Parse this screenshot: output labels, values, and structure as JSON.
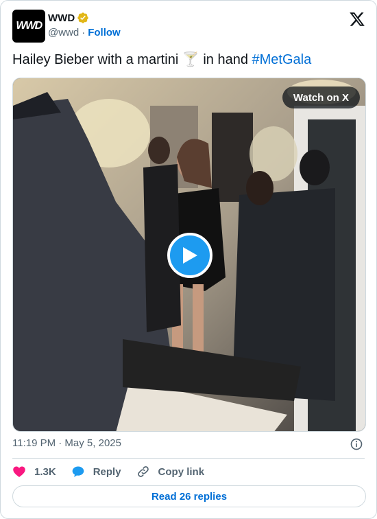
{
  "author": {
    "display_name": "WWD",
    "handle": "@wwd",
    "separator": "·",
    "follow_label": "Follow",
    "avatar_text": "WWD"
  },
  "tweet": {
    "text_before": "Hailey Bieber with a martini 🍸 in hand ",
    "hashtag": "#MetGala"
  },
  "media": {
    "watch_label": "Watch on X"
  },
  "timestamp": "11:19 PM · May 5, 2025",
  "actions": {
    "like_count": "1.3K",
    "reply_label": "Reply",
    "copy_link_label": "Copy link"
  },
  "read_replies_label": "Read 26 replies",
  "colors": {
    "accent": "#006fd6",
    "play": "#1d9bf0",
    "like": "#f91880",
    "text_secondary": "#536471",
    "border": "#cfd9de"
  },
  "icons": [
    "verified-badge-icon",
    "x-logo-icon",
    "play-icon",
    "info-icon",
    "heart-icon",
    "reply-bubble-icon",
    "link-icon"
  ]
}
